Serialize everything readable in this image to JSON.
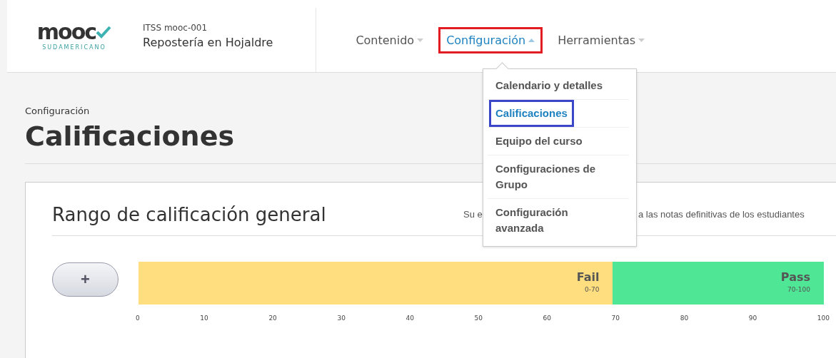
{
  "header": {
    "logo": {
      "text": "mooc",
      "subtitle": "SUDAMERICANO"
    },
    "course_code": "ITSS mooc-001",
    "course_title": "Repostería en Hojaldre",
    "nav": [
      {
        "label": "Contenido",
        "selected": false,
        "annotated": false
      },
      {
        "label": "Configuración",
        "selected": true,
        "annotated": true
      },
      {
        "label": "Herramientas",
        "selected": false,
        "annotated": false
      }
    ]
  },
  "dropdown": {
    "items": [
      {
        "label": "Calendario y detalles",
        "selected": false,
        "annotated": false
      },
      {
        "label": "Calificaciones",
        "selected": true,
        "annotated": true
      },
      {
        "label": "Equipo del curso",
        "selected": false,
        "annotated": false
      },
      {
        "label": "Configuraciones de Grupo",
        "selected": false,
        "annotated": false
      },
      {
        "label": "Configuración avanzada",
        "selected": false,
        "annotated": false
      }
    ]
  },
  "page": {
    "breadcrumb": "Configuración",
    "title": "Calificaciones"
  },
  "card": {
    "title": "Rango de calificación general",
    "description_parts": [
      "Su e",
      "a las notas definitivas de los estudiantes"
    ],
    "add_button": "+",
    "segments": [
      {
        "label": "Fail",
        "range": "0-70",
        "color": "#fede7f"
      },
      {
        "label": "Pass",
        "range": "70-100",
        "color": "#4fe695"
      }
    ],
    "axis_ticks": [
      "0",
      "10",
      "20",
      "30",
      "40",
      "50",
      "60",
      "70",
      "80",
      "90",
      "100"
    ]
  }
}
